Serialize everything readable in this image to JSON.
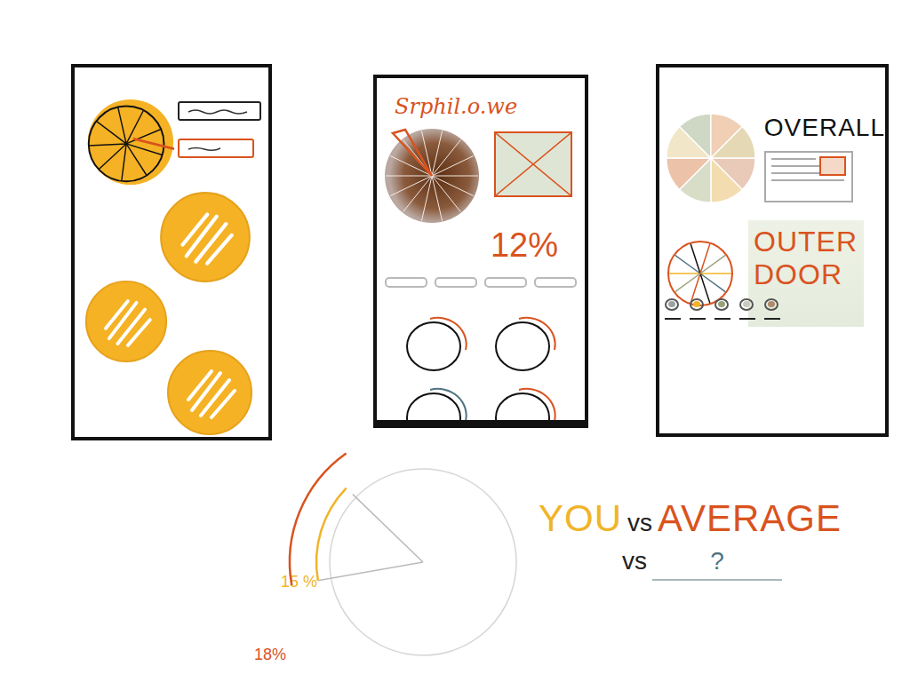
{
  "detail": {
    "title": "Srphil.o.we",
    "stat": "12%"
  },
  "summary": {
    "heading": "OVERALL",
    "category": "OUTER DOOR",
    "filters": [
      {
        "color": "#9aa3a3"
      },
      {
        "color": "#f0b429"
      },
      {
        "color": "#9aa07a"
      },
      {
        "color": "#c9c9c0"
      },
      {
        "color": "#b08a6a"
      }
    ]
  },
  "comparison": {
    "separator": "vs",
    "series": [
      {
        "label": "YOU",
        "value": 15,
        "reading": "15 %",
        "color": "#f0b429"
      },
      {
        "label": "AVERAGE",
        "value": 18,
        "reading": "18%",
        "color": "#d9531e"
      }
    ],
    "other": {
      "label": "?",
      "color": "#4f7282"
    }
  }
}
